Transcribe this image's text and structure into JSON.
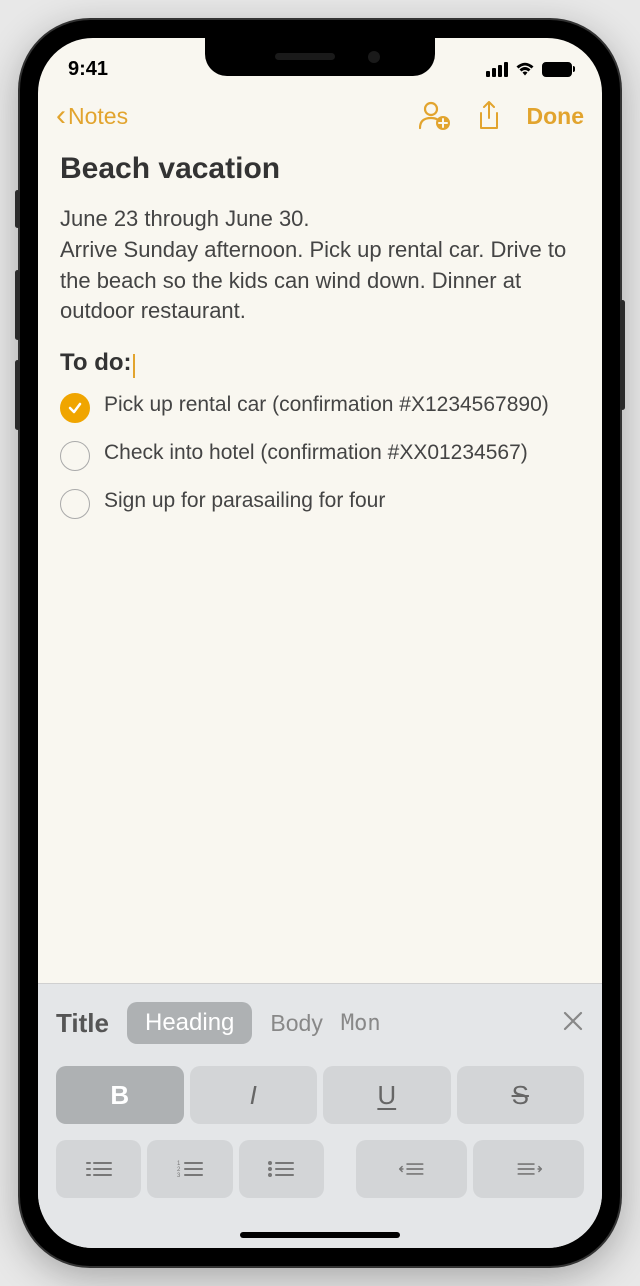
{
  "statusBar": {
    "time": "9:41"
  },
  "nav": {
    "backLabel": "Notes",
    "doneLabel": "Done"
  },
  "note": {
    "title": "Beach vacation",
    "body": "June 23 through June 30.\nArrive Sunday afternoon. Pick up rental car. Drive to the beach so the kids can wind down. Dinner at outdoor restaurant.",
    "todoHeading": "To do:",
    "checklist": [
      {
        "checked": true,
        "text": "Pick up rental car (confirmation #X1234567890)"
      },
      {
        "checked": false,
        "text": "Check into hotel (confirmation #XX01234567)"
      },
      {
        "checked": false,
        "text": "Sign up for parasailing for four"
      }
    ]
  },
  "formatBar": {
    "styles": {
      "title": "Title",
      "heading": "Heading",
      "body": "Body",
      "mono": "Mon"
    },
    "textFormat": {
      "bold": "B",
      "italic": "I",
      "underline": "U",
      "strike": "S"
    }
  }
}
